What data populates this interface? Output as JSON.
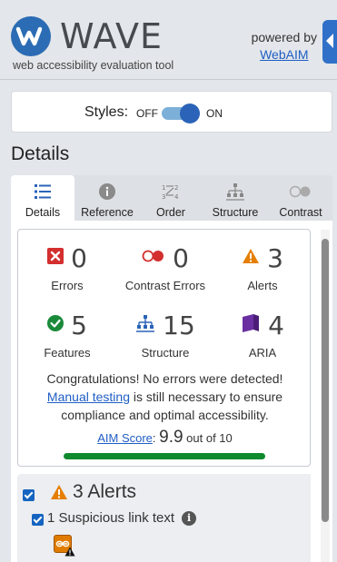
{
  "header": {
    "logo_text": "WAVE",
    "tagline": "web accessibility evaluation tool",
    "powered_by": "powered by",
    "webaim_link": "WebAIM"
  },
  "styles_toggle": {
    "label": "Styles:",
    "off": "OFF",
    "on": "ON",
    "state": "on"
  },
  "section_title": "Details",
  "tabs": [
    {
      "label": "Details",
      "icon": "list-icon",
      "active": true
    },
    {
      "label": "Reference",
      "icon": "info-icon",
      "active": false
    },
    {
      "label": "Order",
      "icon": "order-icon",
      "active": false
    },
    {
      "label": "Structure",
      "icon": "structure-icon",
      "active": false
    },
    {
      "label": "Contrast",
      "icon": "contrast-icon",
      "active": false
    }
  ],
  "summary": {
    "errors": {
      "count": "0",
      "label": "Errors"
    },
    "contrast_errors": {
      "count": "0",
      "label": "Contrast Errors"
    },
    "alerts": {
      "count": "3",
      "label": "Alerts"
    },
    "features": {
      "count": "5",
      "label": "Features"
    },
    "structure": {
      "count": "15",
      "label": "Structure"
    },
    "aria": {
      "count": "4",
      "label": "ARIA"
    },
    "congrats_line": "Congratulations! No errors were detected!",
    "manual_testing_link": "Manual testing",
    "manual_testing_rest": " is still necessary to ensure compliance and optimal accessibility.",
    "aim_score_link": "AIM Score",
    "aim_score_value": "9.9",
    "aim_score_suffix": " out of 10",
    "aim_score_fraction": 0.99
  },
  "alerts_section": {
    "title": "3 Alerts",
    "item_label": "1 Suspicious link text"
  },
  "colors": {
    "accent": "#2b6cb4",
    "error": "#d32f2f",
    "alert": "#e67e00",
    "feature": "#1a8a3a",
    "structure": "#2a63b8",
    "aria": "#6a2fa0",
    "score_bar": "#0f8a2f"
  }
}
